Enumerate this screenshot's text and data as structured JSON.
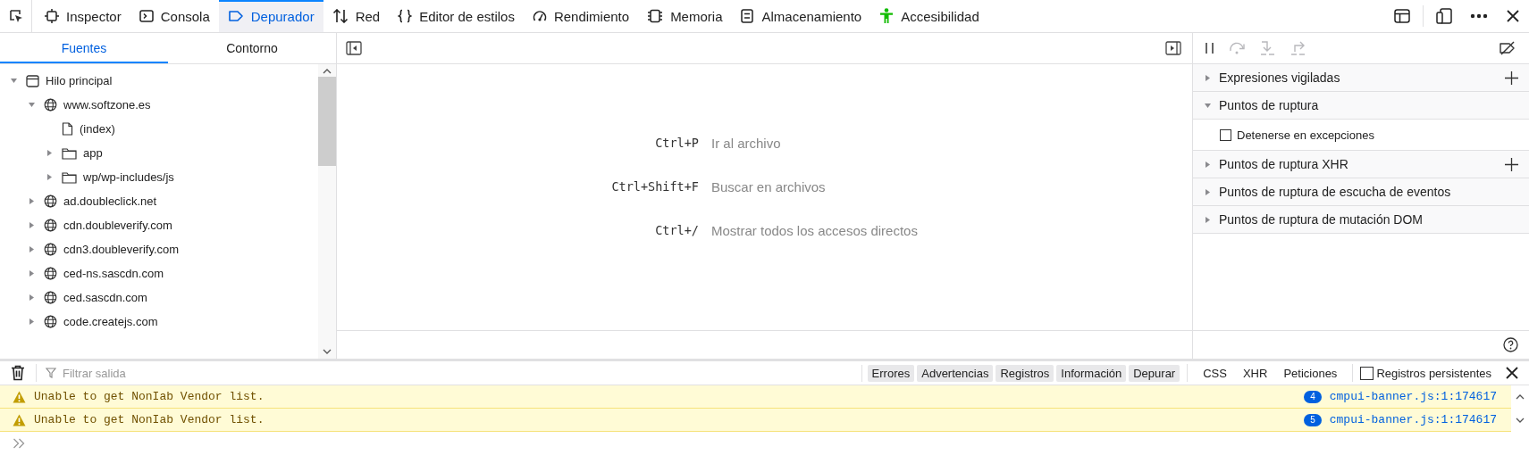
{
  "toolbar": {
    "tools": [
      {
        "label": "Inspector",
        "kind": "inspector",
        "selected": false
      },
      {
        "label": "Consola",
        "kind": "console",
        "selected": false
      },
      {
        "label": "Depurador",
        "kind": "debugger",
        "selected": true
      },
      {
        "label": "Red",
        "kind": "network",
        "selected": false
      },
      {
        "label": "Editor de estilos",
        "kind": "style",
        "selected": false
      },
      {
        "label": "Rendimiento",
        "kind": "performance",
        "selected": false
      },
      {
        "label": "Memoria",
        "kind": "memory",
        "selected": false
      },
      {
        "label": "Almacenamiento",
        "kind": "storage",
        "selected": false
      },
      {
        "label": "Accesibilidad",
        "kind": "accessibility",
        "selected": false
      }
    ]
  },
  "sources": {
    "tabs": [
      {
        "label": "Fuentes",
        "selected": true
      },
      {
        "label": "Contorno",
        "selected": false
      }
    ],
    "tree": [
      {
        "label": "Hilo principal",
        "kind": "thread",
        "expanded": true,
        "children": [
          {
            "label": "www.softzone.es",
            "kind": "domain",
            "expanded": true,
            "children": [
              {
                "label": "(index)",
                "kind": "file"
              },
              {
                "label": "app",
                "kind": "folder",
                "expanded": false
              },
              {
                "label": "wp/wp-includes/js",
                "kind": "folder",
                "expanded": false
              }
            ]
          },
          {
            "label": "ad.doubleclick.net",
            "kind": "domain",
            "expanded": false
          },
          {
            "label": "cdn.doubleverify.com",
            "kind": "domain",
            "expanded": false
          },
          {
            "label": "cdn3.doubleverify.com",
            "kind": "domain",
            "expanded": false
          },
          {
            "label": "ced-ns.sascdn.com",
            "kind": "domain",
            "expanded": false
          },
          {
            "label": "ced.sascdn.com",
            "kind": "domain",
            "expanded": false
          },
          {
            "label": "code.createjs.com",
            "kind": "domain",
            "expanded": false
          }
        ]
      }
    ]
  },
  "editor": {
    "shortcuts": [
      {
        "keys": "Ctrl+P",
        "label": "Ir al archivo"
      },
      {
        "keys": "Ctrl+Shift+F",
        "label": "Buscar en archivos"
      },
      {
        "keys": "Ctrl+/",
        "label": "Mostrar todos los accesos directos"
      }
    ]
  },
  "breakpoints_panel": {
    "sections": [
      {
        "label": "Expresiones vigiladas",
        "expanded": false,
        "add": true
      },
      {
        "label": "Puntos de ruptura",
        "expanded": true,
        "add": false,
        "options": [
          {
            "label": "Detenerse en excepciones",
            "checked": false
          }
        ]
      },
      {
        "label": "Puntos de ruptura XHR",
        "expanded": false,
        "add": true
      },
      {
        "label": "Puntos de ruptura de escucha de eventos",
        "expanded": false,
        "add": false
      },
      {
        "label": "Puntos de ruptura de mutación DOM",
        "expanded": false,
        "add": false
      }
    ]
  },
  "console": {
    "filter": {
      "placeholder": "Filtrar salida"
    },
    "levels": [
      {
        "label": "Errores",
        "selected": true
      },
      {
        "label": "Advertencias",
        "selected": true
      },
      {
        "label": "Registros",
        "selected": true
      },
      {
        "label": "Información",
        "selected": true
      },
      {
        "label": "Depurar",
        "selected": true
      }
    ],
    "types": [
      {
        "label": "CSS",
        "selected": false
      },
      {
        "label": "XHR",
        "selected": false
      },
      {
        "label": "Peticiones",
        "selected": false
      }
    ],
    "persist": {
      "label": "Registros persistentes",
      "checked": false
    },
    "messages": [
      {
        "kind": "warning",
        "text": "Unable to get NonIab Vendor list.",
        "count": "4",
        "source": "cmpui-banner.js:1:174617"
      },
      {
        "kind": "warning",
        "text": "Unable to get NonIab Vendor list.",
        "count": "5",
        "source": "cmpui-banner.js:1:174617"
      }
    ]
  }
}
